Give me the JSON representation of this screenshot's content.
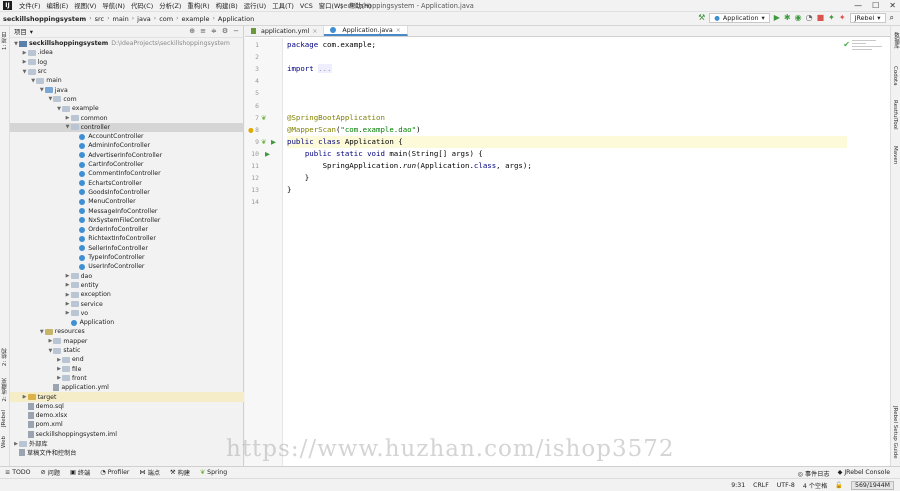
{
  "menubar": {
    "logo": "IJ",
    "items": [
      "文件(F)",
      "编辑(E)",
      "视图(V)",
      "导航(N)",
      "代码(C)",
      "分析(Z)",
      "重构(R)",
      "构建(B)",
      "运行(U)",
      "工具(T)",
      "VCS",
      "窗口(W)",
      "帮助(H)"
    ],
    "window_title": "seckillshoppingsystem - Application.java"
  },
  "navbar": {
    "breadcrumbs": [
      "seckillshoppingsystem",
      "src",
      "main",
      "java",
      "com",
      "example",
      "Application"
    ],
    "run_config": "Application",
    "jrebel": "JRebel"
  },
  "left_strip": {
    "labels": [
      "1: 项目",
      "2: 结构",
      "2: 收藏夹",
      "JRebel",
      "Web"
    ]
  },
  "right_strip": {
    "labels": [
      "数据库",
      "Codota",
      "RestfulTool",
      "Maven",
      "JRebel Setup Guide"
    ]
  },
  "project_panel": {
    "title": "项目",
    "tree": [
      {
        "depth": 0,
        "arrow": "▼",
        "icon": "module",
        "label": "seckillshoppingsystem",
        "hint": "D:\\IdeaProjects\\seckillshoppingsystem",
        "bold": true
      },
      {
        "depth": 1,
        "arrow": "▶",
        "icon": "folder",
        "label": ".idea"
      },
      {
        "depth": 1,
        "arrow": "▶",
        "icon": "folder",
        "label": "log"
      },
      {
        "depth": 1,
        "arrow": "▼",
        "icon": "folder",
        "label": "src"
      },
      {
        "depth": 2,
        "arrow": "▼",
        "icon": "folder",
        "label": "main"
      },
      {
        "depth": 3,
        "arrow": "▼",
        "icon": "folder src",
        "label": "java"
      },
      {
        "depth": 4,
        "arrow": "▼",
        "icon": "folder",
        "label": "com"
      },
      {
        "depth": 5,
        "arrow": "▼",
        "icon": "folder",
        "label": "example"
      },
      {
        "depth": 6,
        "arrow": "▶",
        "icon": "folder",
        "label": "common"
      },
      {
        "depth": 6,
        "arrow": "▼",
        "icon": "folder",
        "label": "controller",
        "selected": true
      },
      {
        "depth": 7,
        "arrow": "",
        "icon": "class",
        "label": "AccountController"
      },
      {
        "depth": 7,
        "arrow": "",
        "icon": "class",
        "label": "AdminInfoController"
      },
      {
        "depth": 7,
        "arrow": "",
        "icon": "class",
        "label": "AdvertiserInfoController"
      },
      {
        "depth": 7,
        "arrow": "",
        "icon": "class",
        "label": "CartInfoController"
      },
      {
        "depth": 7,
        "arrow": "",
        "icon": "class",
        "label": "CommentInfoController"
      },
      {
        "depth": 7,
        "arrow": "",
        "icon": "class",
        "label": "EchartsController"
      },
      {
        "depth": 7,
        "arrow": "",
        "icon": "class",
        "label": "GoodsInfoController"
      },
      {
        "depth": 7,
        "arrow": "",
        "icon": "class",
        "label": "MenuController"
      },
      {
        "depth": 7,
        "arrow": "",
        "icon": "class",
        "label": "MessageInfoController"
      },
      {
        "depth": 7,
        "arrow": "",
        "icon": "class",
        "label": "NxSystemFileController"
      },
      {
        "depth": 7,
        "arrow": "",
        "icon": "class",
        "label": "OrderInfoController"
      },
      {
        "depth": 7,
        "arrow": "",
        "icon": "class",
        "label": "RichtextInfoController"
      },
      {
        "depth": 7,
        "arrow": "",
        "icon": "class",
        "label": "SellerInfoController"
      },
      {
        "depth": 7,
        "arrow": "",
        "icon": "class",
        "label": "TypeInfoController"
      },
      {
        "depth": 7,
        "arrow": "",
        "icon": "class",
        "label": "UserInfoController"
      },
      {
        "depth": 6,
        "arrow": "▶",
        "icon": "folder",
        "label": "dao"
      },
      {
        "depth": 6,
        "arrow": "▶",
        "icon": "folder",
        "label": "entity"
      },
      {
        "depth": 6,
        "arrow": "▶",
        "icon": "folder",
        "label": "exception"
      },
      {
        "depth": 6,
        "arrow": "▶",
        "icon": "folder",
        "label": "service"
      },
      {
        "depth": 6,
        "arrow": "▶",
        "icon": "folder",
        "label": "vo"
      },
      {
        "depth": 6,
        "arrow": "",
        "icon": "class",
        "label": "Application"
      },
      {
        "depth": 3,
        "arrow": "▼",
        "icon": "folder res",
        "label": "resources"
      },
      {
        "depth": 4,
        "arrow": "▶",
        "icon": "folder",
        "label": "mapper"
      },
      {
        "depth": 4,
        "arrow": "▼",
        "icon": "folder",
        "label": "static"
      },
      {
        "depth": 5,
        "arrow": "▶",
        "icon": "folder",
        "label": "end"
      },
      {
        "depth": 5,
        "arrow": "▶",
        "icon": "folder",
        "label": "file"
      },
      {
        "depth": 5,
        "arrow": "▶",
        "icon": "folder",
        "label": "front"
      },
      {
        "depth": 4,
        "arrow": "",
        "icon": "file",
        "label": "application.yml"
      },
      {
        "depth": 1,
        "arrow": "▶",
        "icon": "folder yellow",
        "label": "target",
        "target": true
      },
      {
        "depth": 1,
        "arrow": "",
        "icon": "file",
        "label": "demo.sql"
      },
      {
        "depth": 1,
        "arrow": "",
        "icon": "file",
        "label": "demo.xlsx"
      },
      {
        "depth": 1,
        "arrow": "",
        "icon": "file",
        "label": "pom.xml"
      },
      {
        "depth": 1,
        "arrow": "",
        "icon": "file",
        "label": "seckillshoppingsystem.iml"
      },
      {
        "depth": 0,
        "arrow": "▶",
        "icon": "folder",
        "label": "外部库"
      },
      {
        "depth": 0,
        "arrow": "",
        "icon": "file",
        "label": "草稿文件和控制台"
      }
    ]
  },
  "editor": {
    "tabs": [
      {
        "label": "application.yml",
        "active": false
      },
      {
        "label": "Application.java",
        "active": true
      }
    ],
    "lines": [
      [
        [
          "kw",
          "package "
        ],
        [
          "",
          "com.example;"
        ]
      ],
      [],
      [
        [
          "kw",
          "import "
        ],
        [
          "fold",
          "..."
        ]
      ],
      [],
      [],
      [],
      [
        [
          "ann",
          "@SpringBootApplication"
        ]
      ],
      [
        [
          "ann",
          "@MapperScan"
        ],
        [
          "",
          "("
        ],
        [
          "str",
          "\"com.example.dao\""
        ],
        [
          "",
          ")"
        ]
      ],
      [
        [
          "kw",
          "public class "
        ],
        [
          "",
          "Application {"
        ]
      ],
      [
        [
          "",
          "    "
        ],
        [
          "kw",
          "public static void "
        ],
        [
          "",
          "main(String[] args) {"
        ]
      ],
      [
        [
          "",
          "        SpringApplication."
        ],
        [
          "ital",
          "run"
        ],
        [
          "",
          "(Application."
        ],
        [
          "kw",
          "class"
        ],
        [
          "",
          ", args);"
        ]
      ],
      [
        [
          "",
          "    }"
        ]
      ],
      [
        [
          "",
          "}"
        ]
      ],
      []
    ],
    "highlight_line": 9
  },
  "watermark": "https://www.huzhan.com/ishop3572",
  "toolwindows": [
    "TODO",
    "问题",
    "终端",
    "Profiler",
    "端点",
    "构建",
    "Spring"
  ],
  "toolwindows_right": [
    "事件日志",
    "JRebel Console"
  ],
  "statusbar": {
    "position": "9:31",
    "line_sep": "CRLF",
    "encoding": "UTF-8",
    "indent": "4 个空格",
    "memory": "569/1944M"
  }
}
